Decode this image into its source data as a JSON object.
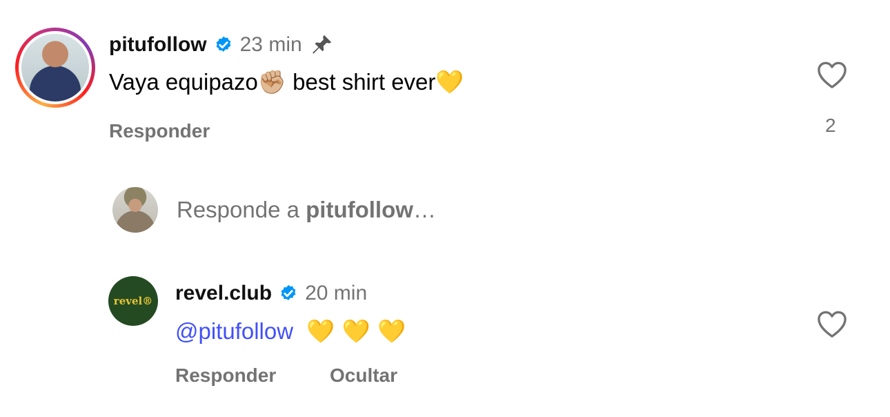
{
  "comment": {
    "username": "pitufollow",
    "time": "23 min",
    "text_part1": "Vaya equipazo",
    "emoji_fist": "✊🏼",
    "text_part2": " best shirt ever",
    "emoji_heart": "💛",
    "reply_label": "Responder",
    "like_count": "2"
  },
  "reply_box": {
    "prefix": "Responde a ",
    "target": "pitufollow",
    "suffix": "…"
  },
  "reply": {
    "username": "revel.club",
    "time": "20 min",
    "mention": "@pitufollow",
    "emojis": "💛 💛 💛",
    "reply_label": "Responder",
    "hide_label": "Ocultar",
    "logo_text": "revel®"
  },
  "colors": {
    "verified": "#0095f6",
    "mention": "#4150f7",
    "muted": "#737373",
    "logo_bg": "#244a22",
    "logo_text": "#e5c534"
  }
}
